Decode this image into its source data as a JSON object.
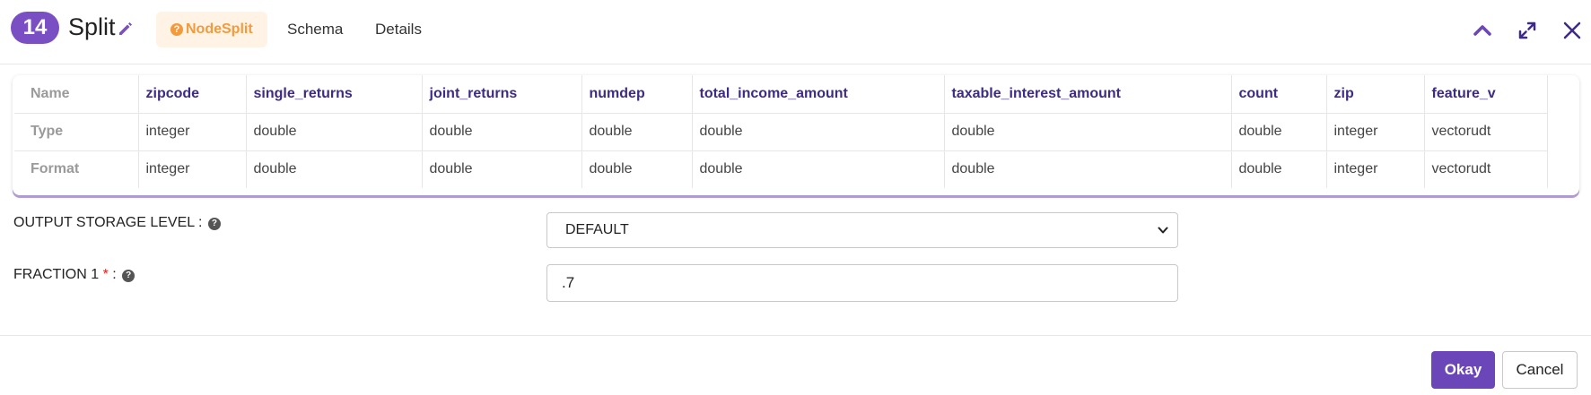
{
  "header": {
    "node_number": "14",
    "node_title": "Split",
    "tabs": [
      {
        "label": "NodeSplit",
        "active": true
      },
      {
        "label": "Schema",
        "active": false
      },
      {
        "label": "Details",
        "active": false
      }
    ],
    "icons": [
      "pencil-icon",
      "chevron-up-icon",
      "expand-icon",
      "close-icon"
    ]
  },
  "schema_table": {
    "row_headers": [
      "Name",
      "Type",
      "Format"
    ],
    "columns": [
      {
        "name": "zipcode",
        "type": "integer",
        "format": "integer"
      },
      {
        "name": "single_returns",
        "type": "double",
        "format": "double"
      },
      {
        "name": "joint_returns",
        "type": "double",
        "format": "double"
      },
      {
        "name": "numdep",
        "type": "double",
        "format": "double"
      },
      {
        "name": "total_income_amount",
        "type": "double",
        "format": "double"
      },
      {
        "name": "taxable_interest_amount",
        "type": "double",
        "format": "double"
      },
      {
        "name": "count",
        "type": "double",
        "format": "double"
      },
      {
        "name": "zip",
        "type": "integer",
        "format": "integer"
      },
      {
        "name": "feature_v",
        "type": "vectorudt",
        "format": "vectorudt"
      }
    ]
  },
  "form": {
    "output_storage_level": {
      "label": "OUTPUT STORAGE LEVEL :",
      "value": "DEFAULT"
    },
    "fraction1": {
      "label": "FRACTION 1",
      "required_marker": "*",
      "colon": ":",
      "value": ".7"
    }
  },
  "footer": {
    "okay_label": "Okay",
    "cancel_label": "Cancel"
  },
  "colors": {
    "accent": "#7a4fc4",
    "tab_active": "#f39a3c",
    "okay_button": "#6a46b8"
  }
}
